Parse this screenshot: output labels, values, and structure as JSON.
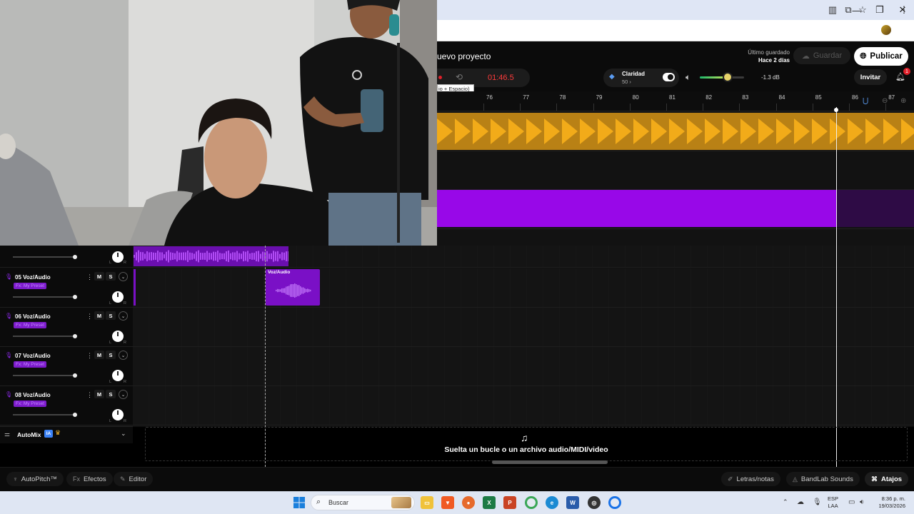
{
  "browser": {
    "window_controls": {
      "minimize": "—",
      "maximize": "❐",
      "close": "✕"
    }
  },
  "header": {
    "project_title": "uevo proyecto",
    "save_status_label": "Último guardado",
    "save_status_time": "Hace 2 días",
    "save_button": "Guardar",
    "publish_button": "Publicar",
    "invite_button": "Invitar",
    "notification_count": "1"
  },
  "transport": {
    "time": "01:46.5",
    "tooltip": "io + Espacio)"
  },
  "clarity": {
    "label": "Claridad",
    "value": "50 ›",
    "enabled": true
  },
  "volume": {
    "db": "-1.3 dB",
    "level_fraction": 0.63
  },
  "ruler": {
    "bars": [
      "76",
      "77",
      "78",
      "79",
      "80",
      "81",
      "82",
      "83",
      "84",
      "85",
      "86",
      "87"
    ]
  },
  "tracks": [
    {
      "number": "05",
      "name": "05  Voz/Audio",
      "fx": "Fx: My Preset"
    },
    {
      "number": "06",
      "name": "06  Voz/Audio",
      "fx": "Fx: My Preset"
    },
    {
      "number": "07",
      "name": "07  Voz/Audio",
      "fx": "Fx: My Preset"
    },
    {
      "number": "08",
      "name": "08  Voz/Audio",
      "fx": "Fx: My Preset"
    }
  ],
  "track_controls": {
    "mute": "M",
    "solo": "S",
    "pan_left": "L",
    "pan_right": "R"
  },
  "clips": {
    "voz_clip_label": "Voz/Audio"
  },
  "automix": {
    "label": "AutoMix",
    "badge": "IA"
  },
  "drop_zone": {
    "text": "Suelta un bucle o un archivo audio/MIDI/video"
  },
  "bottom_bar": {
    "autopitch": "AutoPitch™",
    "effects": "Efectos",
    "editor": "Editor",
    "lyrics": "Letras/notas",
    "sounds": "BandLab Sounds",
    "shortcuts": "Atajos"
  },
  "taskbar": {
    "search_label": "Buscar",
    "lang_top": "ESP",
    "lang_bottom": "LAA",
    "time": "8:36 p. m.",
    "date": "19/03/2026"
  },
  "colors": {
    "accent_purple": "#9808e8",
    "clip_yellow": "#f2ab19",
    "record_red": "#ff3b3b"
  }
}
